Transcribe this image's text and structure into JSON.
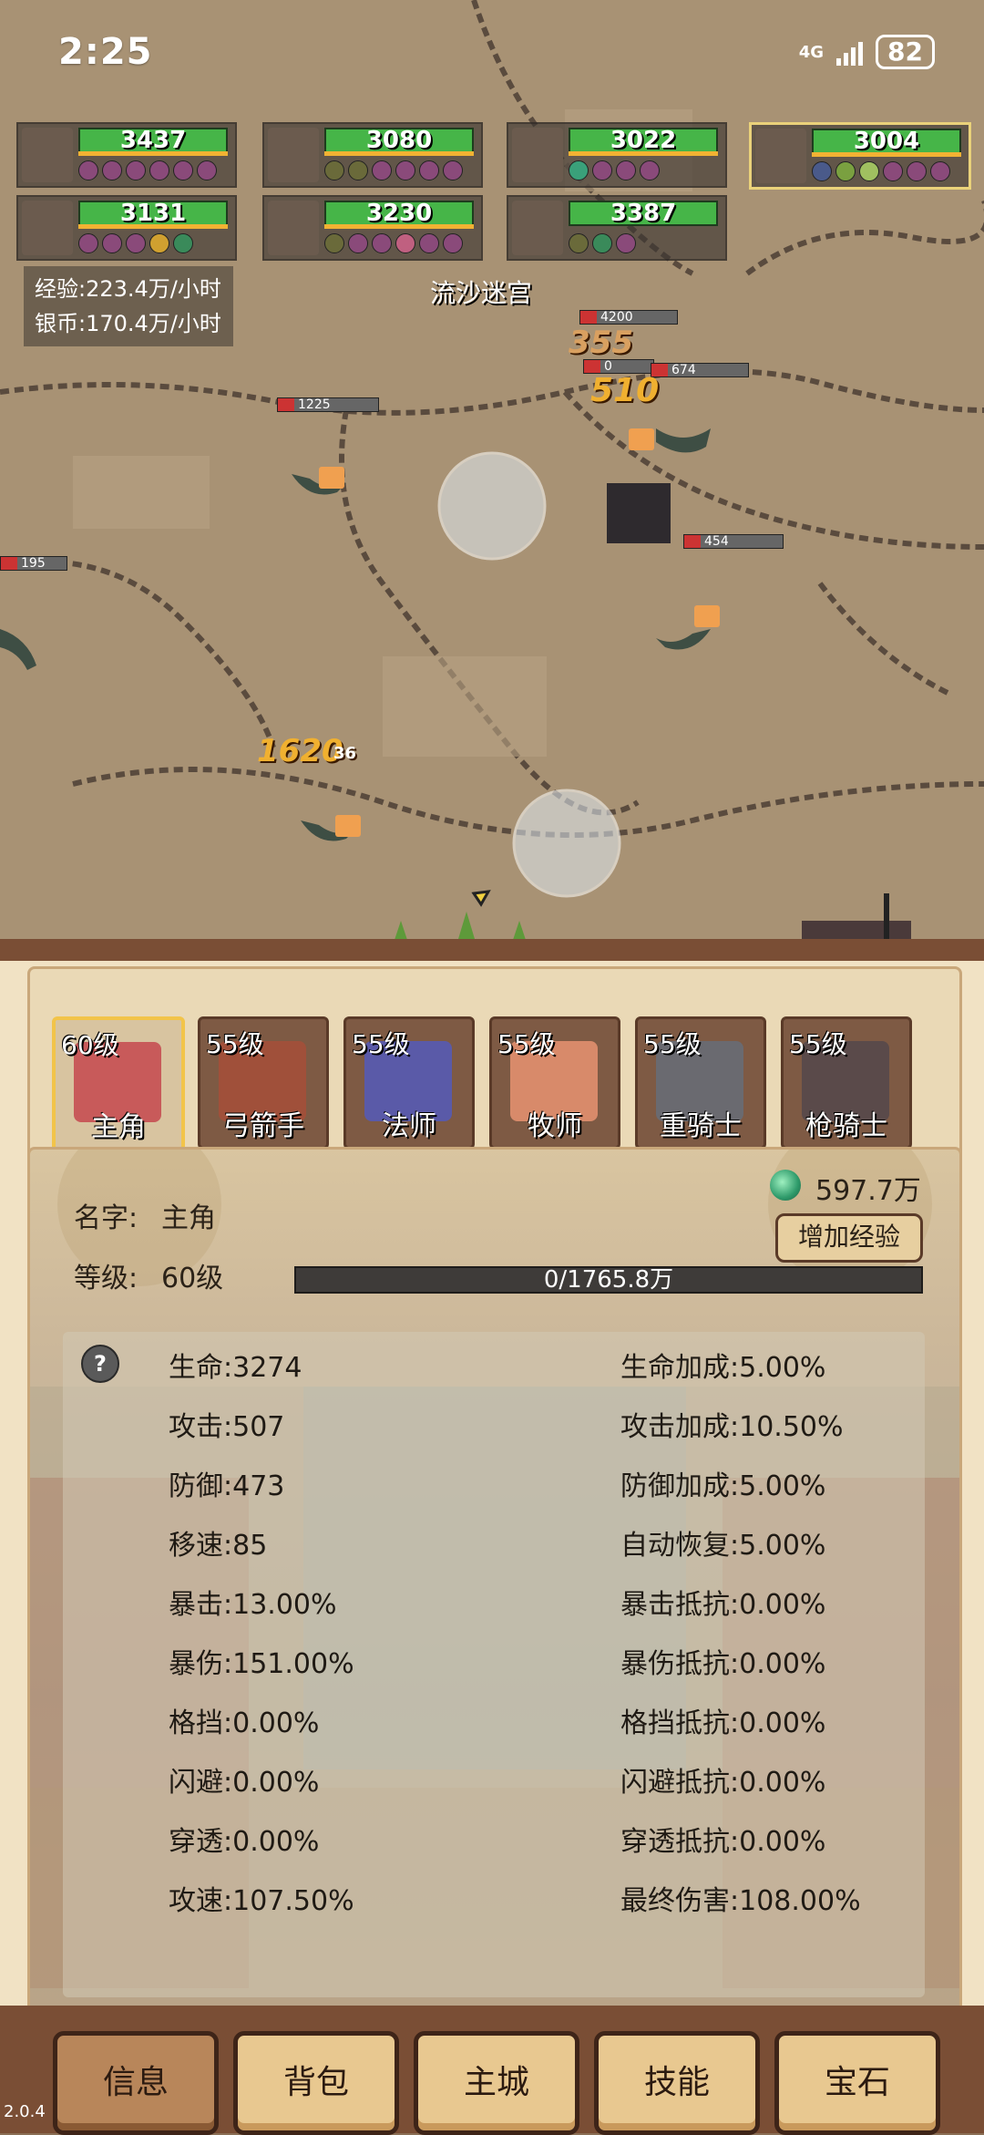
{
  "status_bar": {
    "time": "2:25",
    "network": "4G",
    "battery": "82"
  },
  "party_hp": [
    {
      "hp": "3437",
      "selected": false
    },
    {
      "hp": "3080",
      "selected": false
    },
    {
      "hp": "3022",
      "selected": false
    },
    {
      "hp": "3004",
      "selected": true
    },
    {
      "hp": "3131",
      "selected": false
    },
    {
      "hp": "3230",
      "selected": false
    },
    {
      "hp": "3387",
      "selected": false
    }
  ],
  "rates": {
    "exp": "经验:223.4万/小时",
    "silver": "银币:170.4万/小时"
  },
  "map_name": "流沙迷宫",
  "battle_numbers": {
    "enemy_hp_1": "4200",
    "enemy_hp_2": "0",
    "enemy_hp_3": "674",
    "enemy_hp_4": "1225",
    "enemy_hp_5": "454",
    "enemy_hp_6": "195",
    "dmg_1": "355",
    "dmg_2": "510",
    "dmg_3": "1620",
    "dmg_3_suffix": "36"
  },
  "heroes": [
    {
      "level": "60级",
      "name": "主角",
      "active": true
    },
    {
      "level": "55级",
      "name": "弓箭手",
      "active": false
    },
    {
      "level": "55级",
      "name": "法师",
      "active": false
    },
    {
      "level": "55级",
      "name": "牧师",
      "active": false
    },
    {
      "level": "55级",
      "name": "重骑士",
      "active": false
    },
    {
      "level": "55级",
      "name": "枪骑士",
      "active": false
    }
  ],
  "info": {
    "gem_amount": "597.7万",
    "add_exp_label": "增加经验",
    "name_label": "名字:",
    "name_value": "主角",
    "level_label": "等级:",
    "level_value": "60级",
    "exp_text": "0/1765.8万",
    "help_icon": "?"
  },
  "stats_left": [
    "生命:3274",
    "攻击:507",
    "防御:473",
    "移速:85",
    "暴击:13.00%",
    "暴伤:151.00%",
    "格挡:0.00%",
    "闪避:0.00%",
    "穿透:0.00%",
    "攻速:107.50%"
  ],
  "stats_right": [
    "生命加成:5.00%",
    "攻击加成:10.50%",
    "防御加成:5.00%",
    "自动恢复:5.00%",
    "暴击抵抗:0.00%",
    "暴伤抵抗:0.00%",
    "格挡抵抗:0.00%",
    "闪避抵抗:0.00%",
    "穿透抵抗:0.00%",
    "最终伤害:108.00%"
  ],
  "nav": [
    "信息",
    "背包",
    "主城",
    "技能",
    "宝石"
  ],
  "version": "2.0.4",
  "colors": {
    "hp_green": "#46b548",
    "panel_bg": "#f1e2c4",
    "frame_brown": "#7a4e35",
    "active_gold": "#f2c44a"
  }
}
